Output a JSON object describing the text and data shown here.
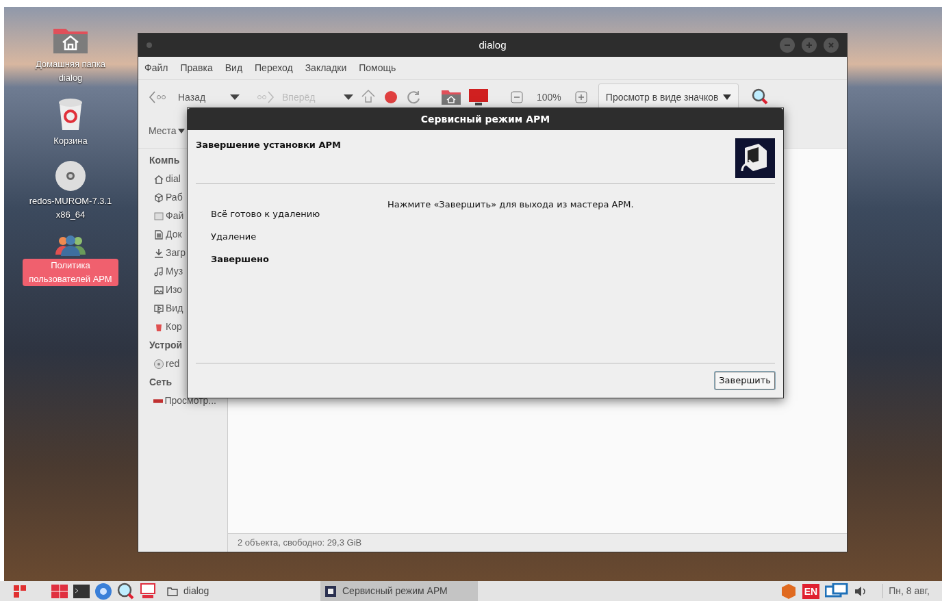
{
  "desktop_icons": [
    {
      "kind": "home",
      "label": "Домашняя папка dialog",
      "selected": false
    },
    {
      "kind": "trash",
      "label": "Корзина",
      "selected": false
    },
    {
      "kind": "disc",
      "label": "redos-MUROM-7.3.1 x86_64",
      "selected": false
    },
    {
      "kind": "users",
      "label": "Политика пользователей АРМ",
      "selected": true
    }
  ],
  "file_manager": {
    "title": "dialog",
    "menu": [
      "Файл",
      "Правка",
      "Вид",
      "Переход",
      "Закладки",
      "Помощь"
    ],
    "toolbar": {
      "back": "Назад",
      "forward": "Вперёд",
      "forward_disabled": true,
      "zoom": "100%",
      "view": "Просмотр в виде значков"
    },
    "places_label": "Места",
    "sidebar": [
      {
        "kind": "header",
        "label": "Компь"
      },
      {
        "kind": "home",
        "label": "dial"
      },
      {
        "kind": "desktop",
        "label": "Раб"
      },
      {
        "kind": "files",
        "label": "Фай"
      },
      {
        "kind": "doc",
        "label": "Док"
      },
      {
        "kind": "download",
        "label": "Загр"
      },
      {
        "kind": "music",
        "label": "Муз"
      },
      {
        "kind": "image",
        "label": "Изо"
      },
      {
        "kind": "video",
        "label": "Вид"
      },
      {
        "kind": "trash",
        "label": "Кор"
      },
      {
        "kind": "header",
        "label": "Устрой"
      },
      {
        "kind": "disc",
        "label": "red"
      },
      {
        "kind": "header",
        "label": "Сеть"
      },
      {
        "kind": "network",
        "label": "Просмотр..."
      }
    ],
    "status": "2 объекта, свободно: 29,3 GiB"
  },
  "dialog": {
    "title": "Сервисный режим АРМ",
    "heading": "Завершение установки АРМ",
    "message": "Нажмите «Завершить» для выхода из мастера АРМ.",
    "steps": [
      {
        "label": "Всё готово к удалению",
        "selected": false
      },
      {
        "label": "Удаление",
        "selected": false
      },
      {
        "label": "Завершено",
        "selected": true
      }
    ],
    "finish_button": "Завершить"
  },
  "taskbar": {
    "tasks": [
      {
        "label": "dialog",
        "kind": "folder",
        "selected": false
      },
      {
        "label": "Сервисный режим АРМ",
        "kind": "wizard",
        "selected": true
      }
    ],
    "language": "EN",
    "clock": "Пн, 8 авг,"
  }
}
